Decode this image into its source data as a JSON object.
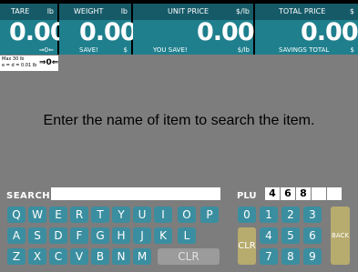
{
  "display": {
    "tare": {
      "label": "TARE",
      "unit": "lb",
      "value": "0.00",
      "zero_mark": "⇒0⇐"
    },
    "weight": {
      "label": "WEIGHT",
      "unit": "lb",
      "value": "0.00",
      "sub_label": "SAVE!",
      "sub_unit": "$"
    },
    "unit_price": {
      "label": "UNIT PRICE",
      "unit": "$/lb",
      "value": "0.00",
      "sub_label": "YOU SAVE!",
      "sub_unit": "$/lb"
    },
    "total_price": {
      "label": "TOTAL PRICE",
      "unit": "$",
      "value": "0.00",
      "sub_label": "SAVINGS TOTAL",
      "sub_unit": "$"
    }
  },
  "scale_info": {
    "max": "Max 30 lb",
    "e_d": "e = d = 0.01 lb",
    "zero": "⇒0⇐"
  },
  "prompt": "Enter the name of item to search the item.",
  "search": {
    "label": "SEARCH",
    "value": ""
  },
  "plu": {
    "label": "PLU",
    "digits": [
      "4",
      "6",
      "8",
      "",
      ""
    ]
  },
  "keyboard": {
    "row1": [
      "Q",
      "W",
      "E",
      "R",
      "T",
      "Y",
      "U",
      "I",
      "O",
      "P"
    ],
    "row2": [
      "A",
      "S",
      "D",
      "F",
      "G",
      "H",
      "J",
      "K",
      "L"
    ],
    "row3": [
      "Z",
      "X",
      "C",
      "V",
      "B",
      "N",
      "M"
    ],
    "clear": "CLR"
  },
  "numpad": {
    "keys": [
      "0",
      "1",
      "2",
      "3",
      "4",
      "5",
      "6",
      "7",
      "8",
      "9"
    ],
    "clear": "CLR",
    "back": "BACK"
  },
  "colors": {
    "key_teal": "#3a8ea0",
    "key_gold": "#b8ab6e",
    "background": "#7d7d7d",
    "display_teal": "#1f7f8d"
  }
}
